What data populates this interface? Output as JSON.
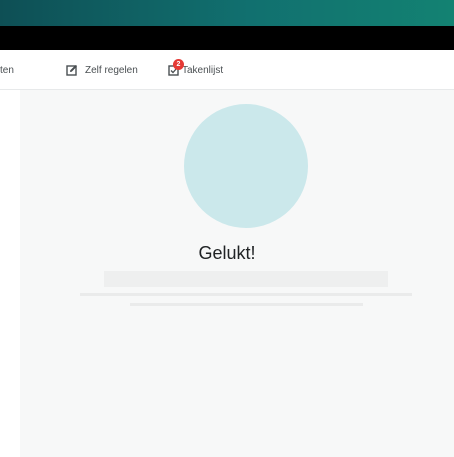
{
  "nav": {
    "items": [
      {
        "label": "ten"
      },
      {
        "label": "Zelf regelen",
        "icon": "edit-icon"
      },
      {
        "label": "Takenlijst",
        "icon": "task-list-icon",
        "badge": "2"
      }
    ]
  },
  "main": {
    "title": "Gelukt!"
  },
  "colors": {
    "header_gradient": "#11706f",
    "badge": "#e53935",
    "circle": "#cbe8eb"
  }
}
